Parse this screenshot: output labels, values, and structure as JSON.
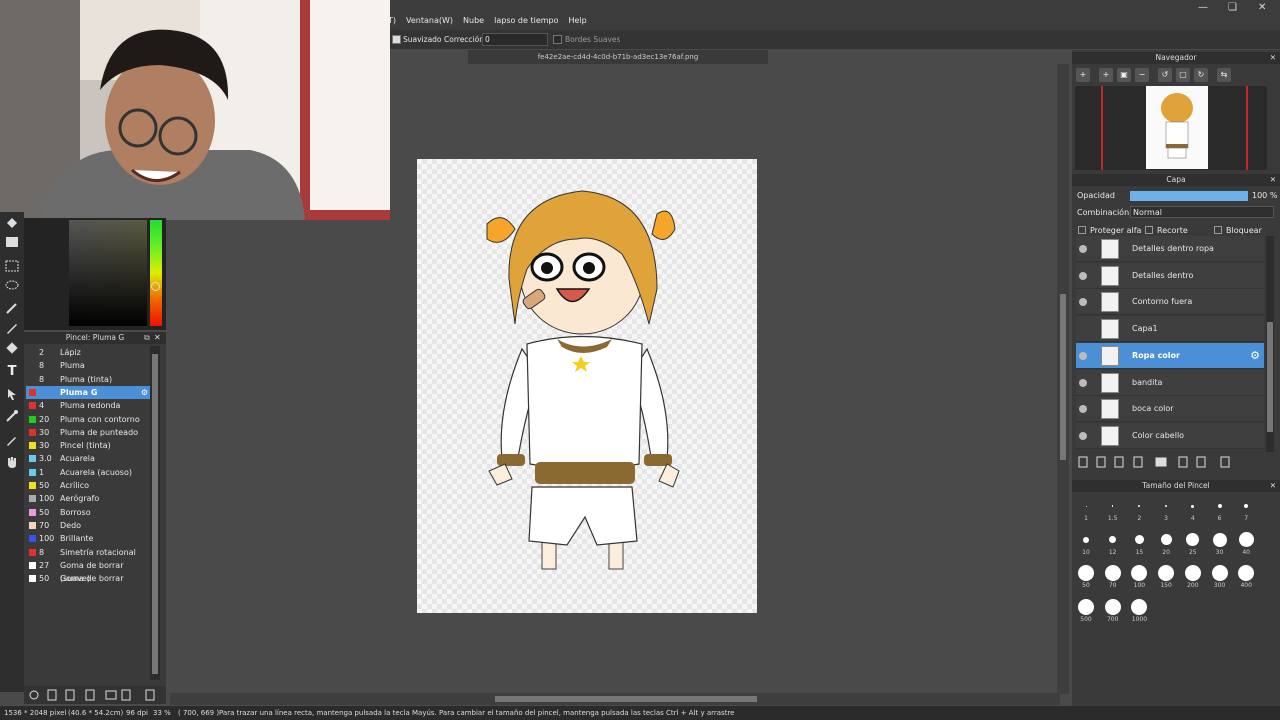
{
  "menu": {
    "items": [
      "a(T)",
      "Ventana(W)",
      "Nube",
      "lapso de tiempo",
      "Help"
    ]
  },
  "tool_options": {
    "smooth_label": "Suavizado",
    "correction_label": "Corrección",
    "correction_value": "0",
    "soft_edges_label": "Bordes Suaves"
  },
  "document_tab": "fe42e2ae-cd4d-4c0d-b71b-ad3ec13e76af.png",
  "brush_panel": {
    "title": "Pincel: Pluma G",
    "brushes": [
      {
        "size": "2",
        "name": "Lápiz",
        "color": "#3a3a3a"
      },
      {
        "size": "8",
        "name": "Pluma",
        "color": "#3a3a3a"
      },
      {
        "size": "8",
        "name": "Pluma (tinta)",
        "color": "#3a3a3a"
      },
      {
        "size": "",
        "name": "Pluma G",
        "color": "#e03030",
        "selected": true
      },
      {
        "size": "4",
        "name": "Pluma redonda",
        "color": "#e03030"
      },
      {
        "size": "20",
        "name": "Pluma con contorno",
        "color": "#22cc22"
      },
      {
        "size": "30",
        "name": "Pluma de punteado",
        "color": "#e03030"
      },
      {
        "size": "30",
        "name": "Pincel (tinta)",
        "color": "#f0e020"
      },
      {
        "size": "3.0",
        "name": "Acuarela",
        "color": "#66ccee"
      },
      {
        "size": "1",
        "name": "Acuarela (acuoso)",
        "color": "#66ccee"
      },
      {
        "size": "50",
        "name": "Acrílico",
        "color": "#f0e020"
      },
      {
        "size": "100",
        "name": "Aerógrafo",
        "color": "#aaaaaa"
      },
      {
        "size": "50",
        "name": "Borroso",
        "color": "#ee99dd"
      },
      {
        "size": "70",
        "name": "Dedo",
        "color": "#f4d6c0"
      },
      {
        "size": "100",
        "name": "Brillante",
        "color": "#3355ee"
      },
      {
        "size": "8",
        "name": "Simetría rotacional",
        "color": "#e03030"
      },
      {
        "size": "27",
        "name": "Goma de borrar (suave)",
        "color": "#ffffff"
      },
      {
        "size": "50",
        "name": "Goma de borrar",
        "color": "#ffffff"
      }
    ]
  },
  "navigator": {
    "title": "Navegador"
  },
  "layers": {
    "title": "Capa",
    "opacity_label": "Opacidad",
    "opacity_value": "100 %",
    "opacity_fraction": 1.0,
    "blend_label": "Combinación",
    "blend_value": "Normal",
    "protect_alpha": "Proteger alfa",
    "clipping": "Recorte",
    "lock": "Bloquear",
    "items": [
      {
        "name": "Detalles dentro ropa"
      },
      {
        "name": "Detalles dentro"
      },
      {
        "name": "Contorno fuera"
      },
      {
        "name": "Capa1"
      },
      {
        "name": "Ropa color",
        "selected": true
      },
      {
        "name": "bandita"
      },
      {
        "name": "boca color"
      },
      {
        "name": "Color cabello"
      }
    ]
  },
  "brush_size": {
    "title": "Tamaño del Pincel",
    "sizes": [
      "1",
      "1.5",
      "2",
      "3",
      "4",
      "6",
      "7",
      "10",
      "12",
      "15",
      "20",
      "25",
      "30",
      "40",
      "50",
      "70",
      "100",
      "150",
      "200",
      "300",
      "400",
      "500",
      "700",
      "1000"
    ]
  },
  "status": {
    "dims": "1536 * 2048 pixel",
    "phys": "(40.6 * 54.2cm)",
    "dpi": "96 dpi",
    "zoom": "33 %",
    "coords": "( 700, 669 )",
    "hint": "Para trazar una línea recta, mantenga pulsada la tecla Mayús. Para cambiar el tamaño del pincel, mantenga pulsada las teclas Ctrl + Alt y arrastre"
  }
}
